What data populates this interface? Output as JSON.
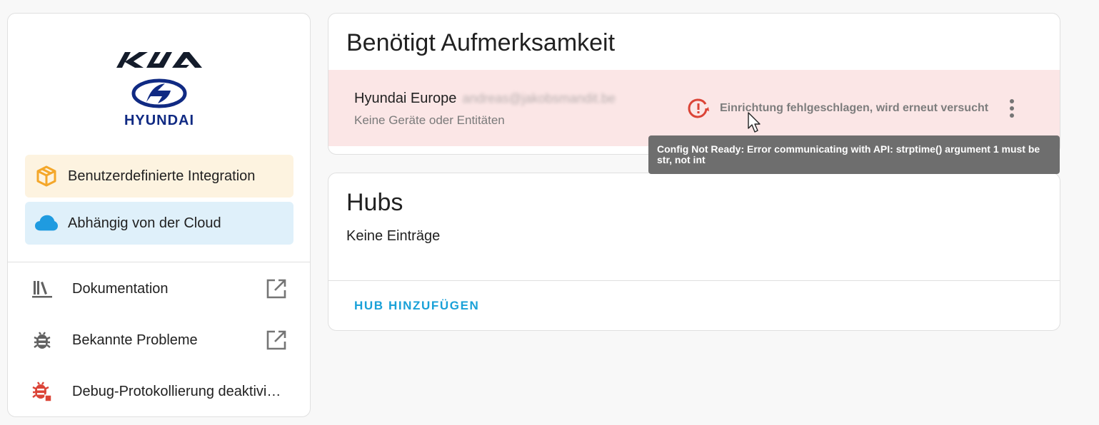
{
  "brand": {
    "logo_icon": "kia-hyundai-logo",
    "logo_text_top": "KIA",
    "logo_text_bottom": "HYUNDAI"
  },
  "badges": [
    {
      "label": "Benutzerdefinierte Integration",
      "icon": "package-icon",
      "color": "#f4a72a"
    },
    {
      "label": "Abhängig von der Cloud",
      "icon": "cloud-icon",
      "color": "#1f9be0"
    }
  ],
  "links": [
    {
      "label": "Dokumentation",
      "icon": "book-shelf-icon",
      "external_icon": "open-in-new-icon"
    },
    {
      "label": "Bekannte Probleme",
      "icon": "bug-icon",
      "external_icon": "open-in-new-icon"
    },
    {
      "label": "Debug-Protokollierung deaktivi…",
      "icon": "bug-stop-icon",
      "color": "#db4437"
    }
  ],
  "attention": {
    "title": "Benötigt Aufmerksamkeit",
    "entry": {
      "name": "Hyundai Europe",
      "email_redacted": "andreas@jakobsmandit.be",
      "subtitle": "Keine Geräte oder Entitäten",
      "status": "Einrichtung fehlgeschlagen, wird erneut versucht",
      "status_icon": "alert-retry-icon",
      "status_color": "#db4437",
      "menu_icon": "dots-vertical-icon"
    },
    "tooltip": "Config Not Ready: Error communicating with API: strptime() argument 1 must be str, not int"
  },
  "hubs": {
    "title": "Hubs",
    "empty_text": "Keine Einträge",
    "add_button": "HUB HINZUFÜGEN"
  },
  "colors": {
    "accent": "#1aa1d8",
    "error_background": "#fbe6e6",
    "custom_badge_background": "#fdf3e0",
    "cloud_badge_background": "#dff0fa"
  }
}
